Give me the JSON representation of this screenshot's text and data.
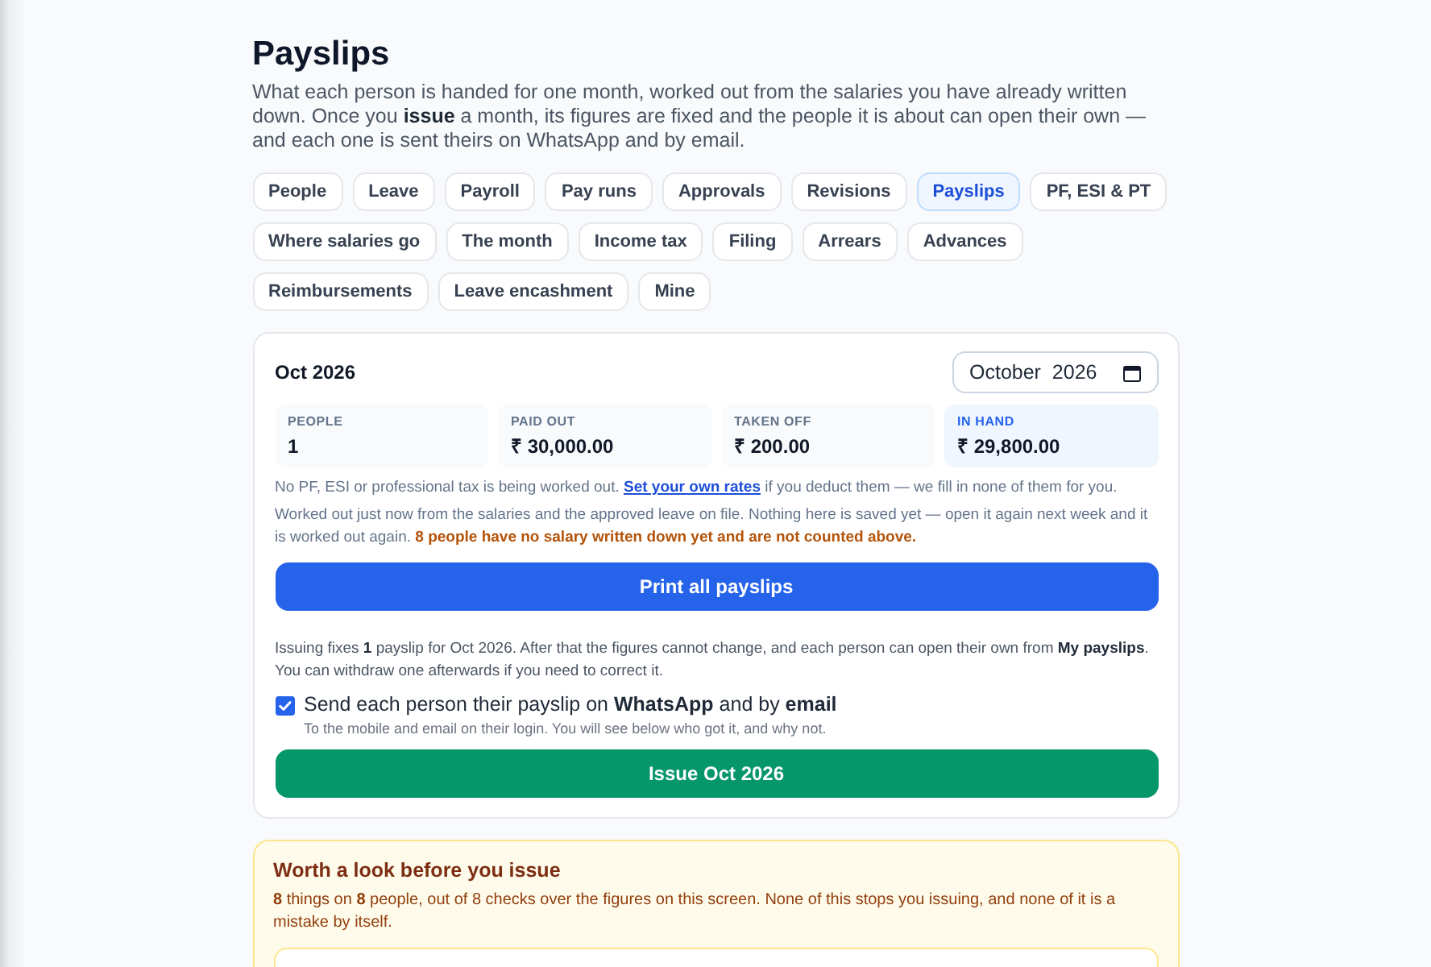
{
  "page": {
    "title": "Payslips",
    "description": "What each person is handed for one month, worked out from the salaries you have already written down. Once you **issue** a month, its figures are fixed and the people it is about can open their own — and each one is sent theirs on WhatsApp and by email."
  },
  "tabs": [
    {
      "label": "People",
      "selected": false
    },
    {
      "label": "Leave",
      "selected": false
    },
    {
      "label": "Payroll",
      "selected": false
    },
    {
      "label": "Pay runs",
      "selected": false
    },
    {
      "label": "Approvals",
      "selected": false
    },
    {
      "label": "Revisions",
      "selected": false
    },
    {
      "label": "Payslips",
      "selected": true
    },
    {
      "label": "PF, ESI & PT",
      "selected": false
    },
    {
      "label": "Where salaries go",
      "selected": false
    },
    {
      "label": "The month",
      "selected": false
    },
    {
      "label": "Income tax",
      "selected": false
    },
    {
      "label": "Filing",
      "selected": false
    },
    {
      "label": "Arrears",
      "selected": false
    },
    {
      "label": "Advances",
      "selected": false
    },
    {
      "label": "Reimbursements",
      "selected": false
    },
    {
      "label": "Leave encashment",
      "selected": false
    },
    {
      "label": "Mine",
      "selected": false
    }
  ],
  "month_card": {
    "heading": "Oct 2026",
    "month_field": {
      "value": "October  2026"
    },
    "stats": [
      {
        "label": "PEOPLE",
        "value": "1",
        "highlighted": false
      },
      {
        "label": "PAID OUT",
        "value": "₹ 30,000.00",
        "highlighted": false
      },
      {
        "label": "TAKEN OFF",
        "value": "₹ 200.00",
        "highlighted": false
      },
      {
        "label": "IN HAND",
        "value": "₹ 29,800.00",
        "highlighted": true
      }
    ],
    "deductions_note": {
      "before": "No PF, ESI or professional tax is being worked out.",
      "link": "Set your own rates",
      "after": "if you deduct them — we fill in none of them for you."
    },
    "computed_note": "Worked out just now from the salaries and the approved leave on file. Nothing here is saved yet — open it again next week and it is worked out again. **8 people have no salary written down yet and are not counted above.**",
    "print_button": "Print all payslips",
    "issue_note": "Issuing fixes **1** payslip for Oct 2026. After that the figures cannot change, and each person can open their own from **My payslips**. You can withdraw one afterwards if you need to correct it.",
    "send_option": {
      "label": "Send each person their payslip on **WhatsApp** and by **email**",
      "hint": "To the mobile and email on their login. You will see below who got it, and why not.",
      "checked": true
    },
    "issue_button": "Issue Oct 2026"
  },
  "warnings": {
    "title": "Worth a look before you issue",
    "summary": "**8** things on **8** people, out of 8 checks over the figures on this screen. None of this stops you issuing, and none of it is a mistake by itself."
  }
}
